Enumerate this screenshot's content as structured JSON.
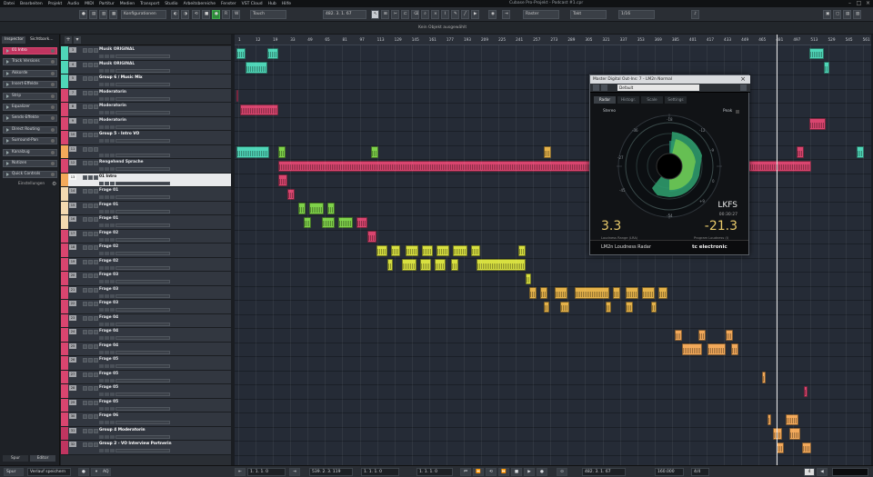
{
  "menubar": {
    "items": [
      "Datei",
      "Bearbeiten",
      "Projekt",
      "Audio",
      "MIDI",
      "Partitur",
      "Medien",
      "Transport",
      "Studio",
      "Arbeitsbereiche",
      "Fenster",
      "VST Cloud",
      "Hub",
      "Hilfe"
    ],
    "title": "Cubase Pro-Projekt - Podcast #1.cpr"
  },
  "toolbar": {
    "config_label": "Konfigurationen",
    "mode_label": "Touch",
    "position": "482. 3. 1. 67",
    "snap_label": "Raster",
    "grid_label": "Takt",
    "quantize_label": "1/16",
    "record_color": "#2e8a3a"
  },
  "infoline": {
    "text": "Kein Objekt ausgewählt"
  },
  "inspector": {
    "tabs": [
      "Inspector",
      "Sichtbark..."
    ],
    "items": [
      {
        "label": "01 Intro",
        "active": true
      },
      {
        "label": "Track Versions",
        "active": false
      },
      {
        "label": "Akkorde",
        "active": false
      },
      {
        "label": "Insert-Effekte",
        "active": false
      },
      {
        "label": "Strip",
        "active": false
      },
      {
        "label": "Equalizer",
        "active": false
      },
      {
        "label": "Sends-Effekte",
        "active": false
      },
      {
        "label": "Direct Routing",
        "active": false
      },
      {
        "label": "Surround-Pan",
        "active": false
      },
      {
        "label": "Kanalzug",
        "active": false
      },
      {
        "label": "Notizen",
        "active": false
      },
      {
        "label": "Quick Controls",
        "active": false
      }
    ],
    "settings_label": "Einstellungen",
    "bottom_tabs": [
      "Spur",
      "Editor"
    ]
  },
  "tracks": [
    {
      "name": "Musik ORIGINAL",
      "color": "#4fd6b8",
      "num": "3"
    },
    {
      "name": "Musik ORIGINAL",
      "color": "#4fd6b8",
      "num": "4"
    },
    {
      "name": "Group 6 / Music Mix",
      "color": "#4fd6b8",
      "num": "5"
    },
    {
      "name": "Moderatorin",
      "color": "#d9456f",
      "num": "7"
    },
    {
      "name": "Moderatorin",
      "color": "#d9456f",
      "num": "8"
    },
    {
      "name": "Moderatorin",
      "color": "#d9456f",
      "num": "9"
    },
    {
      "name": "Group 5 - Intro VO",
      "color": "#d9456f",
      "num": "10"
    },
    {
      "name": "",
      "color": "#f3a95a",
      "num": "11"
    },
    {
      "name": "Rengehend Sprache",
      "color": "#d9456f",
      "num": "12"
    },
    {
      "name": "01 Intro",
      "color": "#f3a95a",
      "num": "13"
    },
    {
      "name": "Frage 01",
      "color": "#f3d9b0",
      "num": "14"
    },
    {
      "name": "Frage 01",
      "color": "#f3d9b0",
      "num": "15"
    },
    {
      "name": "Frage 01",
      "color": "#f3d9b0",
      "num": "16"
    },
    {
      "name": "Frage 02",
      "color": "#d9456f",
      "num": "17"
    },
    {
      "name": "Frage 02",
      "color": "#d9456f",
      "num": "18"
    },
    {
      "name": "Frage 02",
      "color": "#d9456f",
      "num": "19"
    },
    {
      "name": "Frage 03",
      "color": "#d9456f",
      "num": "20"
    },
    {
      "name": "Frage 03",
      "color": "#d9456f",
      "num": "21"
    },
    {
      "name": "Frage 03",
      "color": "#d9456f",
      "num": "22"
    },
    {
      "name": "Frage 04",
      "color": "#d9456f",
      "num": "23"
    },
    {
      "name": "Frage 04",
      "color": "#d9456f",
      "num": "24"
    },
    {
      "name": "Frage 04",
      "color": "#d9456f",
      "num": "25"
    },
    {
      "name": "Frage 05",
      "color": "#d9456f",
      "num": "26"
    },
    {
      "name": "Frage 05",
      "color": "#d9456f",
      "num": "27"
    },
    {
      "name": "Frage 05",
      "color": "#d9456f",
      "num": "28"
    },
    {
      "name": "Frage 05",
      "color": "#d9456f",
      "num": "29"
    },
    {
      "name": "Frage 06",
      "color": "#d9456f",
      "num": "30"
    },
    {
      "name": "Group 4 Moderatorin",
      "color": "#c03560",
      "num": "31"
    },
    {
      "name": "Group 2 - VO Interview Partnerin",
      "color": "#c03560",
      "num": "32"
    }
  ],
  "ruler": {
    "labels": [
      "1",
      "12",
      "19",
      "33",
      "49",
      "65",
      "81",
      "97",
      "113",
      "129",
      "145",
      "161",
      "177",
      "193",
      "209",
      "225",
      "241",
      "257",
      "273",
      "289",
      "305",
      "321",
      "337",
      "353",
      "369",
      "385",
      "401",
      "417",
      "433",
      "449",
      "465",
      "481",
      "497",
      "513",
      "529",
      "545",
      "561"
    ]
  },
  "meter": {
    "title": "Master Digital Out-Ins: 7 - LM2n Normal",
    "preset": "Default",
    "tabs": [
      "Radar",
      "Histogr.",
      "Scale",
      "Settings"
    ],
    "stereo_label": "Stereo",
    "peak_label": "Peak",
    "unit": "LKFS",
    "time": "00:30:27",
    "loudness_range": "3.3",
    "loudness_range_label": "Loudness Range (LRA)",
    "program_loudness": "-21.3",
    "program_loudness_label": "Program Loudness (I)",
    "brand_left": "LM2n Loudness Radar",
    "brand_right": "tc electronic",
    "ring_labels": [
      "-18",
      "-12",
      "-9",
      "0",
      "+9",
      "-36",
      "-27",
      "-45",
      "-54"
    ]
  },
  "transport": {
    "mode": "Verlauf speichern",
    "left_locator": "1. 1. 1. 0",
    "right_locator": "539. 2. 3. 119",
    "position_left": "1. 1. 1. 0",
    "punch": "1. 1. 1. 0",
    "position": "482. 3. 1. 67",
    "tempo": "160.000",
    "signature": "4/4"
  },
  "colors": {
    "accent": "#d9456f",
    "music_clip": "#4fd6b8",
    "green_clip": "#7fd24a",
    "yellow_clip": "#d8e040",
    "gold_clip": "#e5b24a",
    "orange_clip": "#f3a95a"
  }
}
